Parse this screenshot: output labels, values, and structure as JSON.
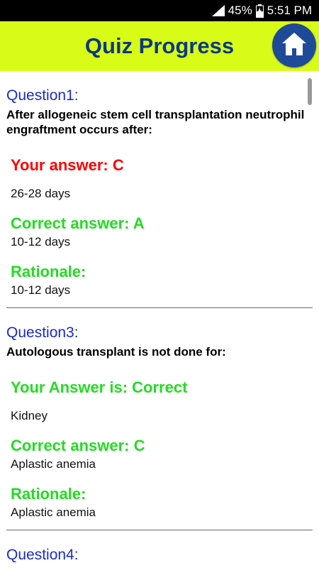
{
  "status_bar": {
    "battery_percent": "45%",
    "time": "5:51 PM"
  },
  "header": {
    "title": "Quiz Progress"
  },
  "questions": [
    {
      "number": "Question1:",
      "text": "After allogeneic stem cell transplantation neutrophil engraftment occurs after:",
      "your_answer_label": "Your answer: C",
      "your_answer_status": "wrong",
      "your_answer_value": "26-28 days",
      "correct_answer_label": "Correct answer: A",
      "correct_answer_value": "10-12 days",
      "rationale_label": "Rationale:",
      "rationale_value": "10-12 days"
    },
    {
      "number": "Question3:",
      "text": "Autologous transplant is not done for:",
      "your_answer_label": "Your Answer is: Correct",
      "your_answer_status": "correct",
      "your_answer_value": "Kidney",
      "correct_answer_label": "Correct answer: C",
      "correct_answer_value": "Aplastic anemia",
      "rationale_label": "Rationale:",
      "rationale_value": "Aplastic anemia"
    },
    {
      "number": "Question4:"
    }
  ],
  "colors": {
    "app_bar": "#d9fb18",
    "title": "#0b3a83",
    "home_button": "#1f4a9a",
    "question_number": "#1a2bd0",
    "wrong": "#ff0000",
    "correct": "#22dd22"
  },
  "icons": {
    "home": "home-icon",
    "signal": "signal-icon",
    "battery": "battery-charging-icon"
  }
}
